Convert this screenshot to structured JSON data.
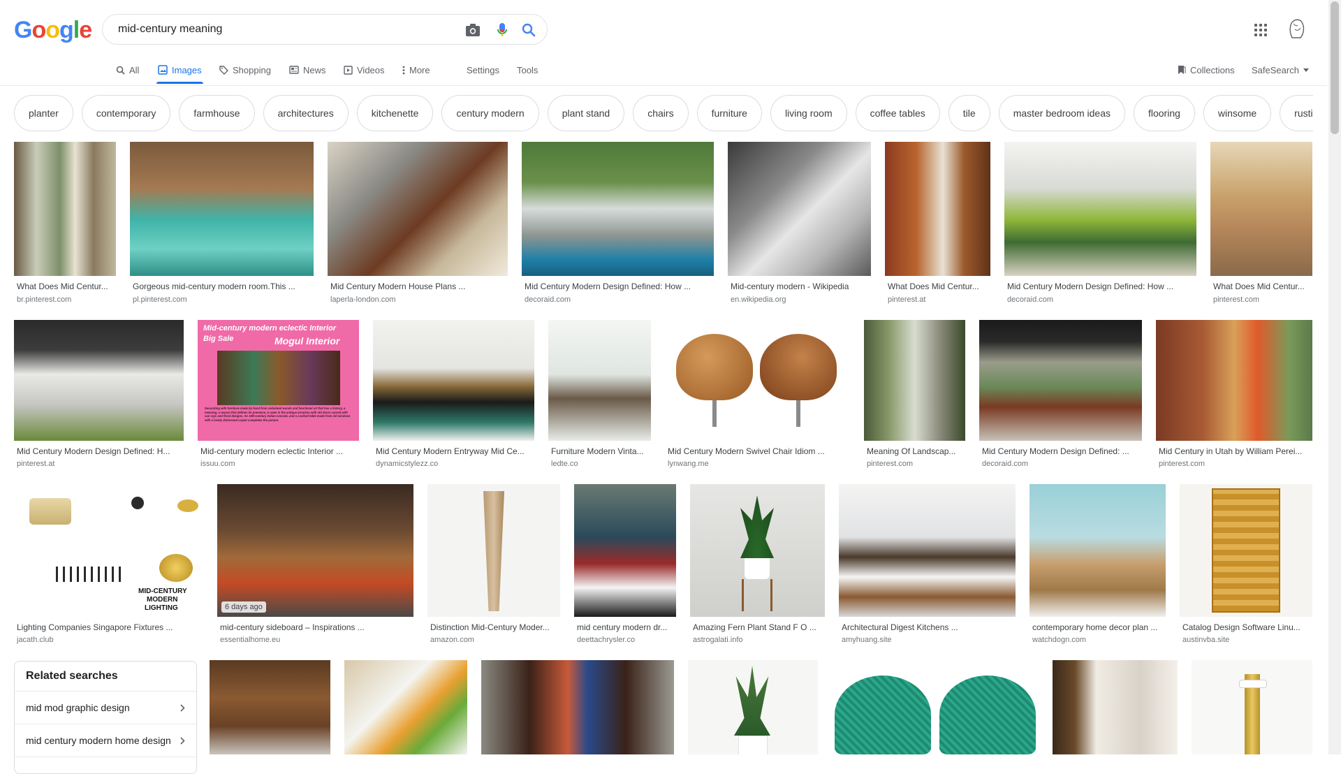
{
  "logo": {
    "letters": [
      "G",
      "o",
      "o",
      "g",
      "l",
      "e"
    ],
    "colors": [
      "#4285F4",
      "#EA4335",
      "#FBBC05",
      "#4285F4",
      "#34A853",
      "#EA4335"
    ]
  },
  "search": {
    "query": "mid-century meaning",
    "icons": [
      "camera-icon",
      "microphone-icon",
      "search-icon"
    ]
  },
  "tabs": [
    {
      "label": "All",
      "icon": "search-icon"
    },
    {
      "label": "Images",
      "icon": "image-icon",
      "active": true
    },
    {
      "label": "Shopping",
      "icon": "tag-icon"
    },
    {
      "label": "News",
      "icon": "news-icon"
    },
    {
      "label": "Videos",
      "icon": "play-icon"
    },
    {
      "label": "More",
      "icon": "more-vert-icon"
    }
  ],
  "settings_label": "Settings",
  "tools_label": "Tools",
  "collections_label": "Collections",
  "safesearch_label": "SafeSearch",
  "chips": [
    "planter",
    "contemporary",
    "farmhouse",
    "architectures",
    "kitchenette",
    "century modern",
    "plant stand",
    "chairs",
    "furniture",
    "living room",
    "coffee tables",
    "tile",
    "master bedroom ideas",
    "flooring",
    "winsome",
    "rustic"
  ],
  "row1": [
    {
      "caption": "What Does Mid Centur...",
      "source": "br.pinterest.com"
    },
    {
      "caption": "Gorgeous mid-century modern room.This ...",
      "source": "pl.pinterest.com"
    },
    {
      "caption": "Mid Century Modern House Plans ...",
      "source": "laperla-london.com"
    },
    {
      "caption": "Mid Century Modern Design Defined: How ...",
      "source": "decoraid.com"
    },
    {
      "caption": "Mid-century modern - Wikipedia",
      "source": "en.wikipedia.org"
    },
    {
      "caption": "What Does Mid Centur...",
      "source": "pinterest.at"
    },
    {
      "caption": "Mid Century Modern Design Defined: How ...",
      "source": "decoraid.com"
    },
    {
      "caption": "What Does Mid Centur...",
      "source": "pinterest.com"
    }
  ],
  "row2": [
    {
      "caption": "Mid Century Modern Design Defined: H...",
      "source": "pinterest.at"
    },
    {
      "caption": "Mid-century modern eclectic Interior ...",
      "source": "issuu.com",
      "overlay": {
        "line1": "Mid-century modern eclectic Interior",
        "line2": "Big Sale",
        "line3": "Mogul Interior",
        "body": "Decorating with furniture made by hand from reclaimed woods and functional art that has a history, a meaning, a reason that defines its presence, is seen in the antique armoires with old doors carved with sun rays and floral designs. An 18th-century Indian console, and a cocktail table made from old windows with a lovely distressed carpet completes the picture."
      }
    },
    {
      "caption": "Mid Century Modern Entryway Mid Ce...",
      "source": "dynamicstylezz.co"
    },
    {
      "caption": "Furniture Modern Vinta...",
      "source": "ledte.co"
    },
    {
      "caption": "Mid Century Modern Swivel Chair Idiom ...",
      "source": "lynwang.me"
    },
    {
      "caption": "Meaning Of Landscap...",
      "source": "pinterest.com"
    },
    {
      "caption": "Mid Century Modern Design Defined: ...",
      "source": "decoraid.com"
    },
    {
      "caption": "Mid Century in Utah by William Perei...",
      "source": "pinterest.com"
    }
  ],
  "row3": [
    {
      "caption": "Lighting Companies Singapore Fixtures ...",
      "source": "jacath.club",
      "overlay": {
        "line1": "MID-CENTURY",
        "line2": "MODERN",
        "line3": "LIGHTING"
      }
    },
    {
      "caption": "mid-century sideboard – Inspirations ...",
      "source": "essentialhome.eu",
      "badge": "6 days ago"
    },
    {
      "caption": "Distinction Mid-Century Moder...",
      "source": "amazon.com"
    },
    {
      "caption": "mid century modern dr...",
      "source": "deettachrysler.co"
    },
    {
      "caption": "Amazing Fern Plant Stand F O ...",
      "source": "astrogalati.info"
    },
    {
      "caption": "Architectural Digest Kitchens ...",
      "source": "amyhuang.site"
    },
    {
      "caption": "contemporary home decor plan ...",
      "source": "watchdogn.com"
    },
    {
      "caption": "Catalog Design Software Linu...",
      "source": "austinvba.site"
    }
  ],
  "related": {
    "title": "Related searches",
    "items": [
      "mid mod graphic design",
      "mid century modern home design"
    ]
  }
}
